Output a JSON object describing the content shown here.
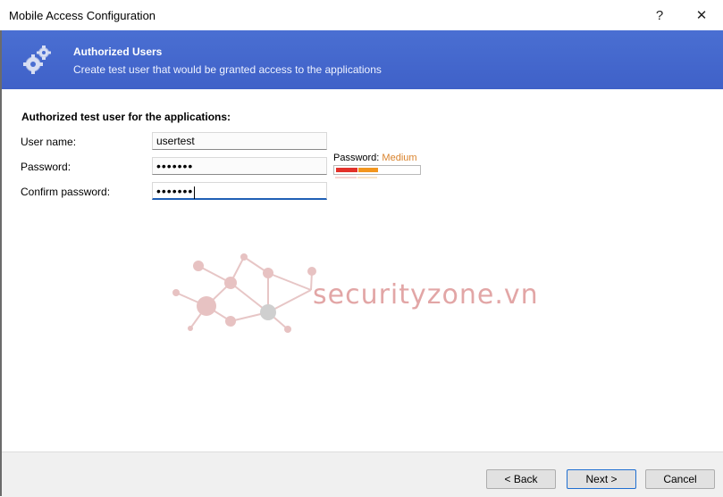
{
  "window": {
    "title": "Mobile Access Configuration",
    "help_label": "?",
    "close_label": "✕"
  },
  "banner": {
    "title": "Authorized Users",
    "subtitle": "Create test user that would be granted access to the applications",
    "icon": "gears-icon",
    "color": "#4a6fd2"
  },
  "form": {
    "heading": "Authorized test user for the applications:",
    "username_label": "User name:",
    "username_value": "usertest",
    "password_label": "Password:",
    "password_value": "•••••••",
    "confirm_label": "Confirm password:",
    "confirm_value": "•••••••",
    "strength_label": "Password:",
    "strength_value": "Medium",
    "strength_color": "#d9822b"
  },
  "watermark": {
    "text": "securityzone.vn"
  },
  "footer": {
    "back_label": "< Back",
    "next_label": "Next >",
    "cancel_label": "Cancel"
  }
}
